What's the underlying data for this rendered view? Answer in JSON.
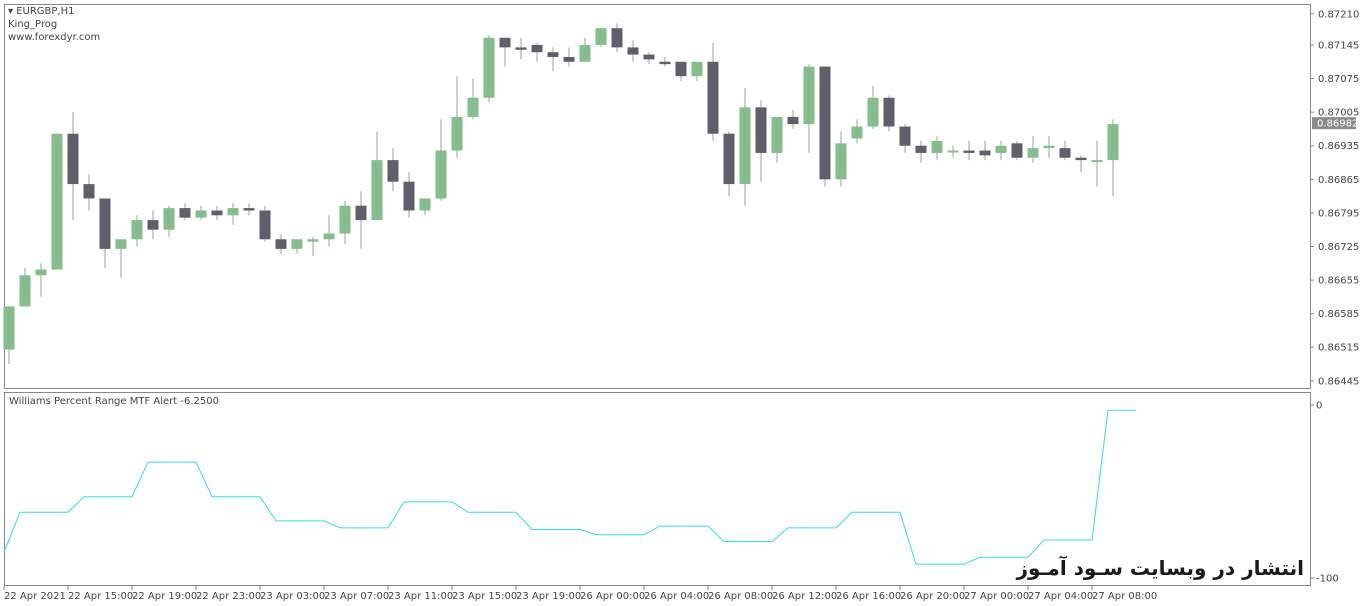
{
  "window": {
    "symbol_label": "EURGBP,H1",
    "expert_name": "King_Prog",
    "site": "www.forexdyr.com"
  },
  "indicator": {
    "title": "Williams Percent Range MTF Alert -6.2500",
    "axis_max_label": "0",
    "axis_min_label": "-100"
  },
  "watermark": "انتشار در وبسایت سـود آمـوز",
  "colors": {
    "bull": "#84be8c",
    "bear": "#5f5f6b",
    "wick": "#bfbfbf",
    "wpr_line": "#33dddd",
    "frame": "#888888",
    "current_price_bg": "#8a8a8a"
  },
  "chart_data": [
    {
      "type": "candlestick",
      "symbol": "EURGBP",
      "timeframe": "H1",
      "y_ticks": [
        "0.87210",
        "0.87145",
        "0.87075",
        "0.87005",
        "0.86935",
        "0.86865",
        "0.86795",
        "0.86725",
        "0.86655",
        "0.86585",
        "0.86515",
        "0.86445"
      ],
      "ylim": [
        0.8643,
        0.8722
      ],
      "current_price": "0.86982",
      "x_tick_labels": [
        "22 Apr 2021",
        "22 Apr 15:00",
        "22 Apr 19:00",
        "22 Apr 23:00",
        "23 Apr 03:00",
        "23 Apr 07:00",
        "23 Apr 11:00",
        "23 Apr 15:00",
        "23 Apr 19:00",
        "26 Apr 00:00",
        "26 Apr 04:00",
        "26 Apr 08:00",
        "26 Apr 12:00",
        "26 Apr 16:00",
        "26 Apr 20:00",
        "27 Apr 00:00",
        "27 Apr 04:00",
        "27 Apr 08:00"
      ],
      "candles": [
        {
          "o": 0.8651,
          "h": 0.866,
          "l": 0.8648,
          "c": 0.866
        },
        {
          "o": 0.866,
          "h": 0.8668,
          "l": 0.866,
          "c": 0.86665
        },
        {
          "o": 0.86665,
          "h": 0.8669,
          "l": 0.8662,
          "c": 0.86677
        },
        {
          "o": 0.86677,
          "h": 0.8696,
          "l": 0.86677,
          "c": 0.8696
        },
        {
          "o": 0.8696,
          "h": 0.87005,
          "l": 0.8678,
          "c": 0.86855
        },
        {
          "o": 0.86855,
          "h": 0.86875,
          "l": 0.868,
          "c": 0.86825
        },
        {
          "o": 0.86825,
          "h": 0.86825,
          "l": 0.8668,
          "c": 0.8672
        },
        {
          "o": 0.8672,
          "h": 0.8674,
          "l": 0.8666,
          "c": 0.8674
        },
        {
          "o": 0.8674,
          "h": 0.8679,
          "l": 0.86725,
          "c": 0.8678
        },
        {
          "o": 0.8678,
          "h": 0.868,
          "l": 0.8674,
          "c": 0.8676
        },
        {
          "o": 0.8676,
          "h": 0.8681,
          "l": 0.86745,
          "c": 0.86805
        },
        {
          "o": 0.86805,
          "h": 0.86815,
          "l": 0.8678,
          "c": 0.86785
        },
        {
          "o": 0.86785,
          "h": 0.8681,
          "l": 0.8678,
          "c": 0.868
        },
        {
          "o": 0.868,
          "h": 0.8681,
          "l": 0.8678,
          "c": 0.8679
        },
        {
          "o": 0.8679,
          "h": 0.86815,
          "l": 0.8677,
          "c": 0.86805
        },
        {
          "o": 0.86805,
          "h": 0.86815,
          "l": 0.8679,
          "c": 0.868
        },
        {
          "o": 0.868,
          "h": 0.8681,
          "l": 0.86735,
          "c": 0.8674
        },
        {
          "o": 0.8674,
          "h": 0.8675,
          "l": 0.8671,
          "c": 0.8672
        },
        {
          "o": 0.8672,
          "h": 0.8674,
          "l": 0.8671,
          "c": 0.8674
        },
        {
          "o": 0.86735,
          "h": 0.86745,
          "l": 0.86705,
          "c": 0.8674
        },
        {
          "o": 0.8674,
          "h": 0.8679,
          "l": 0.86725,
          "c": 0.86752
        },
        {
          "o": 0.86752,
          "h": 0.8682,
          "l": 0.8673,
          "c": 0.8681
        },
        {
          "o": 0.8681,
          "h": 0.8684,
          "l": 0.8672,
          "c": 0.8678
        },
        {
          "o": 0.8678,
          "h": 0.86965,
          "l": 0.8678,
          "c": 0.86905
        },
        {
          "o": 0.86905,
          "h": 0.8693,
          "l": 0.8684,
          "c": 0.8686
        },
        {
          "o": 0.8686,
          "h": 0.8688,
          "l": 0.86785,
          "c": 0.868
        },
        {
          "o": 0.868,
          "h": 0.8682,
          "l": 0.8679,
          "c": 0.86825
        },
        {
          "o": 0.86825,
          "h": 0.8699,
          "l": 0.8682,
          "c": 0.86925
        },
        {
          "o": 0.86925,
          "h": 0.8708,
          "l": 0.8691,
          "c": 0.86995
        },
        {
          "o": 0.86995,
          "h": 0.87075,
          "l": 0.8699,
          "c": 0.87035
        },
        {
          "o": 0.87035,
          "h": 0.87165,
          "l": 0.87025,
          "c": 0.8716
        },
        {
          "o": 0.8716,
          "h": 0.8716,
          "l": 0.871,
          "c": 0.8714
        },
        {
          "o": 0.8714,
          "h": 0.8716,
          "l": 0.87115,
          "c": 0.87135
        },
        {
          "o": 0.87145,
          "h": 0.8715,
          "l": 0.8711,
          "c": 0.8713
        },
        {
          "o": 0.8713,
          "h": 0.8714,
          "l": 0.8709,
          "c": 0.8712
        },
        {
          "o": 0.8712,
          "h": 0.8714,
          "l": 0.871,
          "c": 0.8711
        },
        {
          "o": 0.8711,
          "h": 0.8716,
          "l": 0.8711,
          "c": 0.87145
        },
        {
          "o": 0.87145,
          "h": 0.8718,
          "l": 0.8714,
          "c": 0.8718
        },
        {
          "o": 0.8718,
          "h": 0.8719,
          "l": 0.8713,
          "c": 0.8714
        },
        {
          "o": 0.8714,
          "h": 0.87155,
          "l": 0.8711,
          "c": 0.87125
        },
        {
          "o": 0.87125,
          "h": 0.8713,
          "l": 0.87105,
          "c": 0.87115
        },
        {
          "o": 0.8711,
          "h": 0.8712,
          "l": 0.871,
          "c": 0.87105
        },
        {
          "o": 0.8711,
          "h": 0.8711,
          "l": 0.8707,
          "c": 0.8708
        },
        {
          "o": 0.8708,
          "h": 0.8711,
          "l": 0.8707,
          "c": 0.8711
        },
        {
          "o": 0.8711,
          "h": 0.8715,
          "l": 0.86945,
          "c": 0.8696
        },
        {
          "o": 0.8696,
          "h": 0.86965,
          "l": 0.8683,
          "c": 0.86855
        },
        {
          "o": 0.86855,
          "h": 0.87055,
          "l": 0.8681,
          "c": 0.87015
        },
        {
          "o": 0.87015,
          "h": 0.8703,
          "l": 0.8686,
          "c": 0.8692
        },
        {
          "o": 0.8692,
          "h": 0.8699,
          "l": 0.869,
          "c": 0.86995
        },
        {
          "o": 0.86995,
          "h": 0.8701,
          "l": 0.8697,
          "c": 0.8698
        },
        {
          "o": 0.8698,
          "h": 0.87105,
          "l": 0.8692,
          "c": 0.871
        },
        {
          "o": 0.871,
          "h": 0.871,
          "l": 0.8685,
          "c": 0.86865
        },
        {
          "o": 0.86865,
          "h": 0.86965,
          "l": 0.8685,
          "c": 0.8694
        },
        {
          "o": 0.8695,
          "h": 0.8699,
          "l": 0.8694,
          "c": 0.86975
        },
        {
          "o": 0.86975,
          "h": 0.8706,
          "l": 0.8697,
          "c": 0.87035
        },
        {
          "o": 0.87035,
          "h": 0.8704,
          "l": 0.86965,
          "c": 0.86975
        },
        {
          "o": 0.86975,
          "h": 0.8698,
          "l": 0.8692,
          "c": 0.86935
        },
        {
          "o": 0.86935,
          "h": 0.86945,
          "l": 0.869,
          "c": 0.8692
        },
        {
          "o": 0.8692,
          "h": 0.86955,
          "l": 0.86905,
          "c": 0.86945
        },
        {
          "o": 0.86925,
          "h": 0.86935,
          "l": 0.8691,
          "c": 0.86925
        },
        {
          "o": 0.86925,
          "h": 0.86945,
          "l": 0.86905,
          "c": 0.8692
        },
        {
          "o": 0.86925,
          "h": 0.86945,
          "l": 0.86905,
          "c": 0.86915
        },
        {
          "o": 0.8692,
          "h": 0.86945,
          "l": 0.86905,
          "c": 0.86935
        },
        {
          "o": 0.8694,
          "h": 0.86945,
          "l": 0.86905,
          "c": 0.8691
        },
        {
          "o": 0.8691,
          "h": 0.86955,
          "l": 0.869,
          "c": 0.8693
        },
        {
          "o": 0.8693,
          "h": 0.86955,
          "l": 0.8691,
          "c": 0.86935
        },
        {
          "o": 0.8693,
          "h": 0.86945,
          "l": 0.86905,
          "c": 0.8691
        },
        {
          "o": 0.8691,
          "h": 0.86915,
          "l": 0.8688,
          "c": 0.86905
        },
        {
          "o": 0.86905,
          "h": 0.86945,
          "l": 0.8685,
          "c": 0.86905
        },
        {
          "o": 0.86905,
          "h": 0.8699,
          "l": 0.8683,
          "c": 0.8698
        }
      ]
    },
    {
      "type": "line",
      "title": "Williams Percent Range MTF Alert -6.2500",
      "ylim": [
        -100,
        0
      ],
      "y_ticks": [
        "0",
        "-100"
      ],
      "series": [
        {
          "values": [
            -85,
            -62,
            -62,
            -62,
            -62,
            -53,
            -53,
            -53,
            -53,
            -33,
            -33,
            -33,
            -33,
            -53,
            -53,
            -53,
            -53,
            -67,
            -67,
            -67,
            -67,
            -71,
            -71,
            -71,
            -71,
            -56,
            -56,
            -56,
            -56,
            -62,
            -62,
            -62,
            -62,
            -72,
            -72,
            -72,
            -72,
            -75,
            -75,
            -75,
            -75,
            -70,
            -70,
            -70,
            -70,
            -79,
            -79,
            -79,
            -79,
            -71,
            -71,
            -71,
            -71,
            -62,
            -62,
            -62,
            -62,
            -92,
            -92,
            -92,
            -92,
            -88,
            -88,
            -88,
            -88,
            -78,
            -78,
            -78,
            -78,
            -3,
            -3
          ]
        }
      ]
    }
  ]
}
